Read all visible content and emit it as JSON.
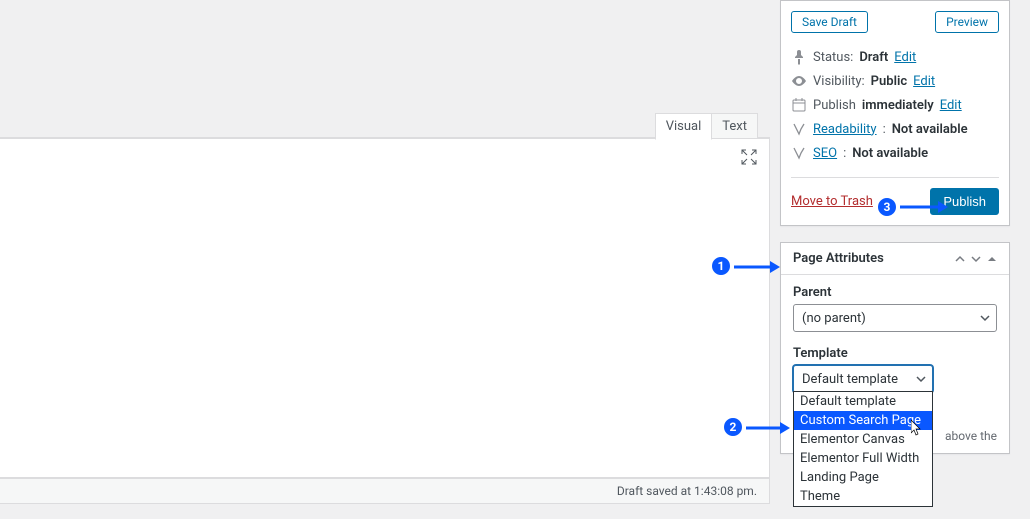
{
  "editor": {
    "tab_visual": "Visual",
    "tab_text": "Text"
  },
  "statusbar": {
    "draft_saved": "Draft saved at 1:43:08 pm."
  },
  "publish": {
    "save_draft": "Save Draft",
    "preview": "Preview",
    "status_label": "Status:",
    "status_value": "Draft",
    "status_edit": "Edit",
    "visibility_label": "Visibility:",
    "visibility_value": "Public",
    "visibility_edit": "Edit",
    "publish_label": "Publish",
    "publish_value": "immediately",
    "publish_edit": "Edit",
    "readability_label": "Readability",
    "readability_value": "Not available",
    "seo_label": "SEO",
    "seo_value": "Not available",
    "trash": "Move to Trash",
    "publish_button": "Publish"
  },
  "attributes": {
    "box_title": "Page Attributes",
    "parent_label": "Parent",
    "parent_value": "(no parent)",
    "template_label": "Template",
    "template_value": "Default template",
    "options": [
      "Default template",
      "Custom Search Page",
      "Elementor Canvas",
      "Elementor Full Width",
      "Landing Page",
      "Theme"
    ],
    "helper": "above the"
  },
  "steps": {
    "one": "1",
    "two": "2",
    "three": "3"
  }
}
